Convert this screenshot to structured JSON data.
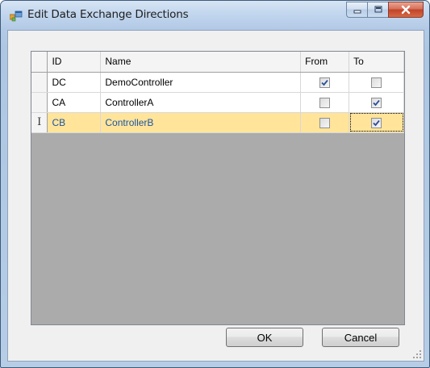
{
  "window": {
    "title": "Edit Data Exchange Directions",
    "icon": "form-app-icon"
  },
  "caption_buttons": [
    "minimize",
    "maximize",
    "close"
  ],
  "grid": {
    "columns": [
      "ID",
      "Name",
      "From",
      "To"
    ],
    "rows": [
      {
        "id": "DC",
        "name": "DemoController",
        "from": true,
        "to": false,
        "selected": false
      },
      {
        "id": "CA",
        "name": "ControllerA",
        "from": false,
        "to": true,
        "selected": false
      },
      {
        "id": "CB",
        "name": "ControllerB",
        "from": false,
        "to": true,
        "selected": true
      }
    ],
    "edit_cursor_glyph": "I"
  },
  "buttons": {
    "ok_label": "OK",
    "cancel_label": "Cancel"
  },
  "colors": {
    "selected_row_bg": "#ffe49a",
    "selected_row_text": "#1b55a4",
    "close_button": "#c2432a"
  }
}
